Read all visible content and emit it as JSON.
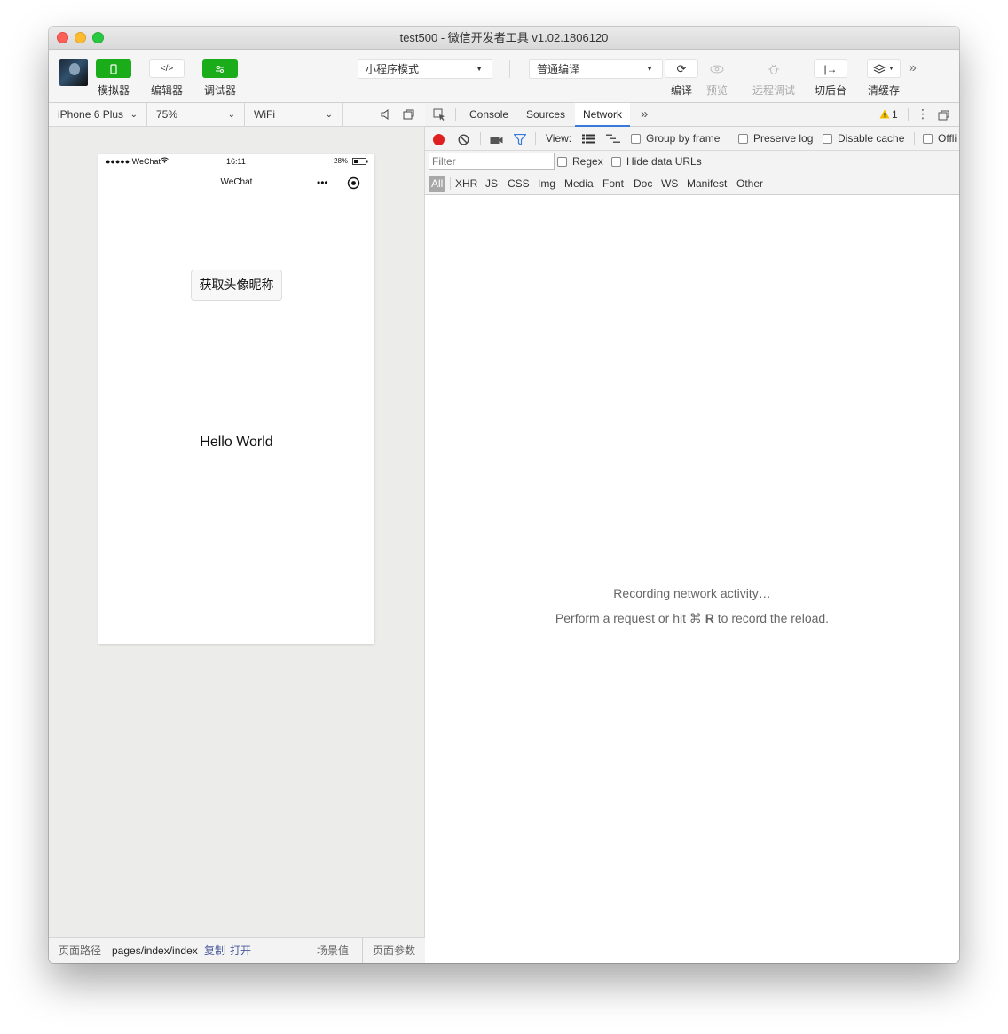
{
  "window": {
    "title": "test500 - 微信开发者工具 v1.02.1806120"
  },
  "toolbar": {
    "simulator_label": "模拟器",
    "editor_label": "编辑器",
    "debugger_label": "调试器",
    "editor_icon_text": "</>",
    "mode_select": "小程序模式",
    "compile_select": "普通编译",
    "compile_label": "编译",
    "preview_label": "预览",
    "remote_debug_label": "远程调试",
    "background_label": "切后台",
    "clear_cache_label": "清缓存"
  },
  "device_bar": {
    "device": "iPhone 6 Plus",
    "zoom": "75%",
    "network": "WiFi"
  },
  "phone": {
    "carrier": "●●●●● WeChat",
    "time": "16:11",
    "battery": "28%",
    "nav_title": "WeChat",
    "button_label": "获取头像昵称",
    "hello_text": "Hello World"
  },
  "bottom_bar": {
    "path_label": "页面路径",
    "path_value": "pages/index/index",
    "copy_link": "复制",
    "open_link": "打开",
    "scene_label": "场景值",
    "params_label": "页面参数"
  },
  "devtools": {
    "tabs": [
      "Console",
      "Sources",
      "Network"
    ],
    "active_tab": "Network",
    "warning_count": "1",
    "view_label": "View:",
    "group_by_frame": "Group by frame",
    "preserve_log": "Preserve log",
    "disable_cache": "Disable cache",
    "offline": "Offli",
    "filter_placeholder": "Filter",
    "regex": "Regex",
    "hide_data_urls": "Hide data URLs",
    "types": [
      "All",
      "XHR",
      "JS",
      "CSS",
      "Img",
      "Media",
      "Font",
      "Doc",
      "WS",
      "Manifest",
      "Other"
    ],
    "empty_line1": "Recording network activity…",
    "empty_line2_pre": "Perform a request or hit ⌘ ",
    "empty_line2_key": "R",
    "empty_line2_post": " to record the reload."
  },
  "colors": {
    "accent_green": "#1aad19",
    "record_red": "#e02020",
    "tab_active_blue": "#3879d9",
    "filter_blue": "#3879d9"
  }
}
